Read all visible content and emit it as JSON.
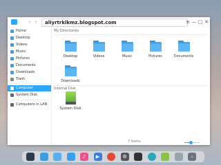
{
  "window": {
    "url": "aliyrtrklkmz.blogspot.com",
    "back": "‹",
    "forward": "›",
    "controls": [
      "≡",
      "—",
      "□",
      "✕"
    ]
  },
  "sidebar": {
    "items": [
      {
        "label": "Home",
        "icon": "home-icon",
        "color": "#3aa0e8"
      },
      {
        "label": "Desktop",
        "icon": "desktop-icon",
        "color": "#3aa0e8"
      },
      {
        "label": "Videos",
        "icon": "video-icon",
        "color": "#3aa0e8"
      },
      {
        "label": "Music",
        "icon": "music-icon",
        "color": "#3aa0e8"
      },
      {
        "label": "Pictures",
        "icon": "picture-icon",
        "color": "#3aa0e8"
      },
      {
        "label": "Documents",
        "icon": "document-icon",
        "color": "#3aa0e8"
      },
      {
        "label": "Downloads",
        "icon": "download-icon",
        "color": "#3aa0e8"
      },
      {
        "label": "Trash",
        "icon": "trash-icon",
        "color": "#888888"
      },
      {
        "label": "Computer",
        "icon": "computer-icon",
        "color": "#ffffff",
        "selected": true
      },
      {
        "label": "System Disk",
        "icon": "disk-icon",
        "color": "#666666"
      },
      {
        "label": "Computers in LAN",
        "icon": "network-icon",
        "color": "#666666"
      }
    ]
  },
  "main": {
    "my_directories_title": "My Directories",
    "internal_disk_title": "Internal Disk",
    "folders": [
      {
        "label": "Desktop",
        "icon": "desktop-folder-icon"
      },
      {
        "label": "Videos",
        "icon": "video-folder-icon"
      },
      {
        "label": "Music",
        "icon": "music-folder-icon"
      },
      {
        "label": "Pictures",
        "icon": "picture-folder-icon"
      },
      {
        "label": "Documents",
        "icon": "document-folder-icon"
      },
      {
        "label": "Downloads",
        "icon": "download-folder-icon"
      }
    ],
    "disk": {
      "label": "System Disk",
      "icon": "system-disk-icon"
    }
  },
  "status": {
    "text": "7 items",
    "zoom_fraction": 0.45
  },
  "dock": {
    "items": [
      {
        "icon": "launcher-icon",
        "color": "#2b3a4f",
        "glyph": ""
      },
      {
        "icon": "multitask-icon",
        "color": "#3b9ee0",
        "glyph": ""
      },
      {
        "icon": "files-icon",
        "color": "#58b0f0",
        "glyph": ""
      },
      {
        "icon": "store-icon",
        "color": "#3aa0e8",
        "glyph": ""
      },
      {
        "icon": "music-app-icon",
        "color": "#e8548a",
        "glyph": "♪"
      },
      {
        "icon": "video-app-icon",
        "color": "#3d7fd8",
        "glyph": "▶"
      },
      {
        "icon": "browser-icon",
        "color": "#e04a3a",
        "glyph": ""
      },
      {
        "icon": "settings-icon",
        "color": "#555555",
        "glyph": "⚙"
      },
      {
        "icon": "terminal-icon",
        "color": "#333333",
        "glyph": ""
      },
      {
        "icon": "camera-icon",
        "color": "#2aa6b8",
        "glyph": ""
      },
      {
        "icon": "android-icon",
        "color": "#8bc34a",
        "glyph": ""
      },
      {
        "icon": "trash-dock-icon",
        "color": "#9aa4ad",
        "glyph": ""
      },
      {
        "icon": "tray-icon",
        "color": "#6a737c",
        "glyph": "›"
      }
    ]
  }
}
